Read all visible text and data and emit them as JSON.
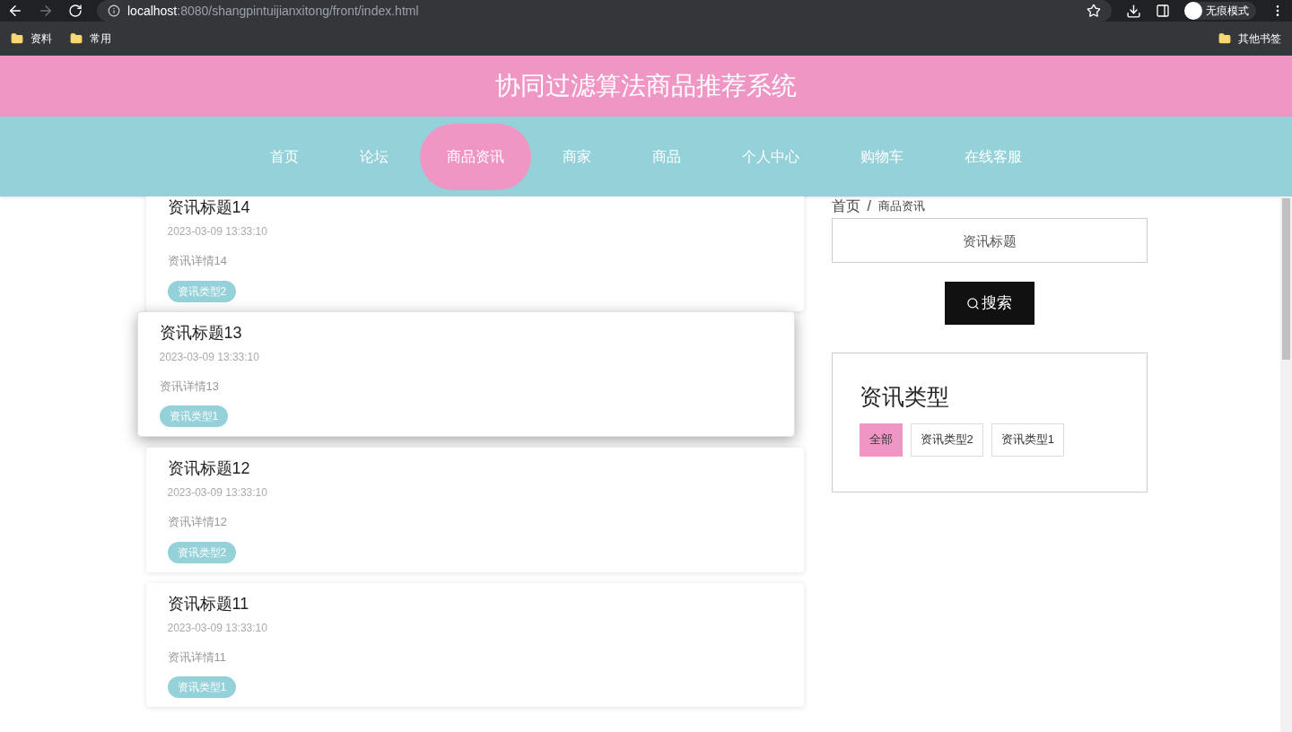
{
  "browser": {
    "url_host": "localhost",
    "url_rest": ":8080/shangpintuijianxitong/front/index.html",
    "profile": "无痕模式",
    "bookmarks": [
      "资料",
      "常用"
    ],
    "other_bookmarks": "其他书签"
  },
  "header": {
    "title": "协同过滤算法商品推荐系统"
  },
  "nav": [
    {
      "label": "首页",
      "selected": false
    },
    {
      "label": "论坛",
      "selected": false
    },
    {
      "label": "商品资讯",
      "selected": true
    },
    {
      "label": "商家",
      "selected": false
    },
    {
      "label": "商品",
      "selected": false
    },
    {
      "label": "个人中心",
      "selected": false
    },
    {
      "label": "购物车",
      "selected": false
    },
    {
      "label": "在线客服",
      "selected": false
    }
  ],
  "news": [
    {
      "title": "资讯标题14",
      "time": "2023-03-09 13:33:10",
      "detail": "资讯详情14",
      "tag": "资讯类型2",
      "hovered": false
    },
    {
      "title": "资讯标题13",
      "time": "2023-03-09 13:33:10",
      "detail": "资讯详情13",
      "tag": "资讯类型1",
      "hovered": true
    },
    {
      "title": "资讯标题12",
      "time": "2023-03-09 13:33:10",
      "detail": "资讯详情12",
      "tag": "资讯类型2",
      "hovered": false
    },
    {
      "title": "资讯标题11",
      "time": "2023-03-09 13:33:10",
      "detail": "资讯详情11",
      "tag": "资讯类型1",
      "hovered": false
    }
  ],
  "breadcrumb": [
    "首页",
    "/",
    "商品资讯"
  ],
  "search": {
    "placeholder": "资讯标题",
    "button": "搜索"
  },
  "categories": {
    "title": "资讯类型",
    "items": [
      {
        "label": "全部",
        "selected": true
      },
      {
        "label": "资讯类型2",
        "selected": false
      },
      {
        "label": "资讯类型1",
        "selected": false
      }
    ]
  }
}
